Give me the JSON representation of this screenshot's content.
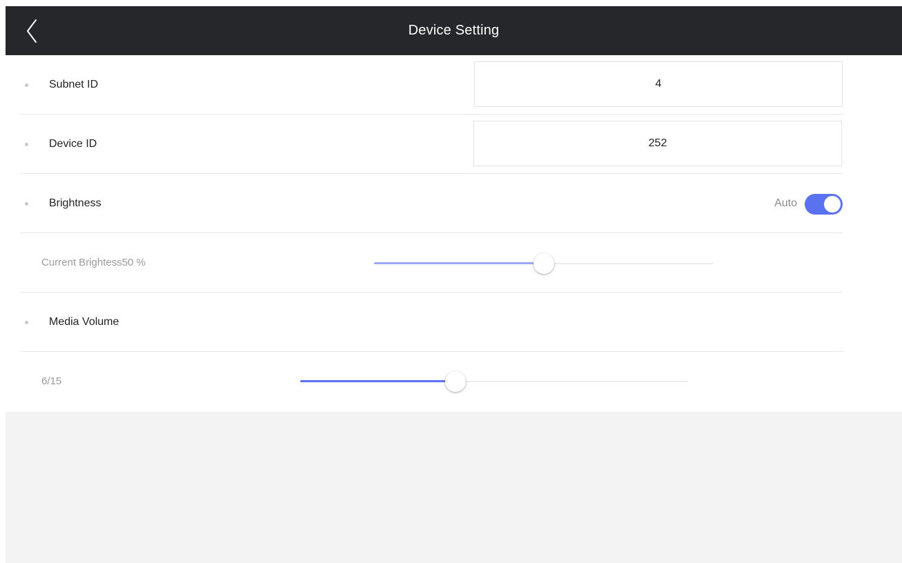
{
  "header": {
    "title": "Device Setting",
    "back_icon": "chevron-left-icon",
    "background": "#25272a"
  },
  "settings": {
    "subnet": {
      "label": "Subnet ID",
      "value": "4"
    },
    "device": {
      "label": "Device ID",
      "value": "252"
    },
    "brightness": {
      "label": "Brightness",
      "auto_label": "Auto",
      "auto_enabled": true
    },
    "current_brightness": {
      "label": "Current Brightess50 %",
      "value_percent": 50
    },
    "media_volume": {
      "label": "Media Volume"
    },
    "volume": {
      "label": "6/15",
      "current": 6,
      "max": 15
    }
  },
  "colors": {
    "accent": "#5b72f0",
    "brightness_fill": "#9aa8f5",
    "volume_fill": "#5b72f0"
  }
}
